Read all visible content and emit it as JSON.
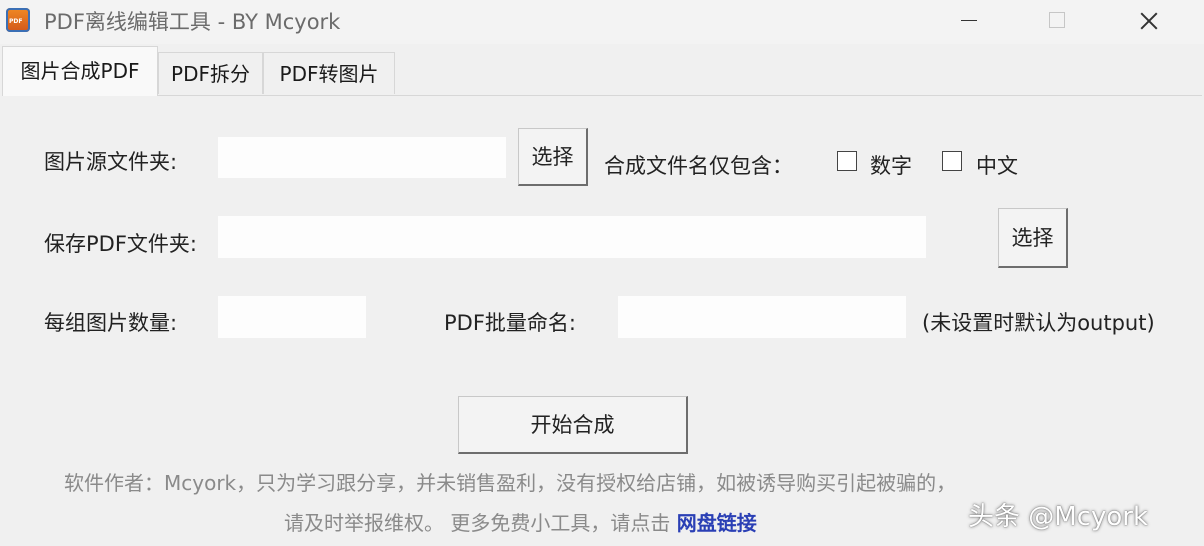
{
  "window": {
    "title": "PDF离线编辑工具 - BY Mcyork"
  },
  "tabs": [
    {
      "label": "图片合成PDF",
      "active": true
    },
    {
      "label": "PDF拆分",
      "active": false
    },
    {
      "label": "PDF转图片",
      "active": false
    }
  ],
  "form": {
    "source_folder_label": "图片源文件夹:",
    "source_folder_value": "",
    "source_select_label": "选择",
    "filename_filter_label": "合成文件名仅包含：",
    "digits_checkbox_label": "数字",
    "digits_checked": false,
    "chinese_checkbox_label": "中文",
    "chinese_checked": false,
    "save_folder_label": "保存PDF文件夹:",
    "save_folder_value": "",
    "save_select_label": "选择",
    "images_per_group_label": "每组图片数量:",
    "images_per_group_value": "",
    "batch_name_label": "PDF批量命名:",
    "batch_name_value": "",
    "batch_name_hint": "(未设置时默认为output)",
    "start_button_label": "开始合成"
  },
  "footer": {
    "line1": "软件作者：Mcyork，只为学习跟分享，并未销售盈利，没有授权给店铺，如被诱导购买引起被骗的，",
    "line2_text": "请及时举报维权。 更多免费小工具，请点击",
    "link_label": "网盘链接"
  },
  "watermark": "头条 @Mcyork",
  "colors": {
    "window_bg": "#f0f0f0",
    "link": "#2a3fb5",
    "footer_text": "#8a8a8a"
  }
}
